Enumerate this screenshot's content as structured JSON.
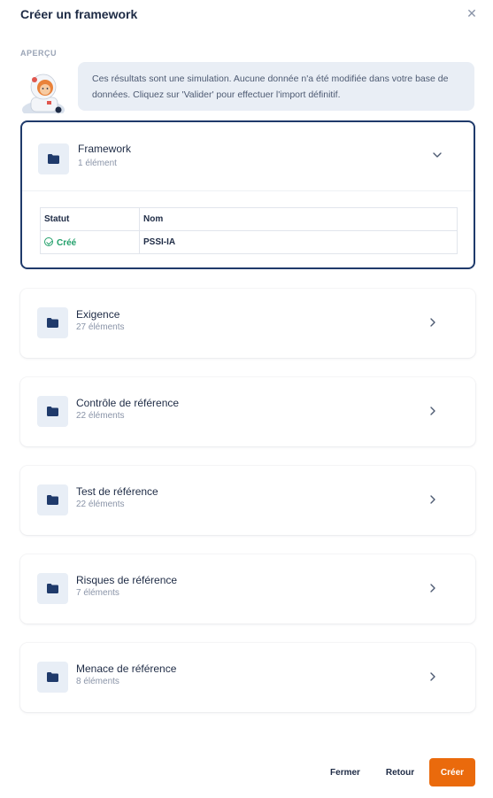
{
  "modal": {
    "title": "Créer un framework",
    "close_icon": "close-icon"
  },
  "preview": {
    "label": "APERÇU",
    "message": "Ces résultats sont une simulation. Aucune donnée n'a été modifiée dans votre base de données. Cliquez sur 'Valider' pour effectuer l'import définitif."
  },
  "cards": [
    {
      "title": "Framework",
      "subtitle": "1 élément",
      "expanded": true
    },
    {
      "title": "Exigence",
      "subtitle": "27 éléments",
      "expanded": false
    },
    {
      "title": "Contrôle de référence",
      "subtitle": "22 éléments",
      "expanded": false
    },
    {
      "title": "Test de référence",
      "subtitle": "22 éléments",
      "expanded": false
    },
    {
      "title": "Risques de référence",
      "subtitle": "7 éléments",
      "expanded": false
    },
    {
      "title": "Menace de référence",
      "subtitle": "8 éléments",
      "expanded": false
    }
  ],
  "framework_table": {
    "headers": [
      "Statut",
      "Nom"
    ],
    "rows": [
      {
        "status": "Créé",
        "name": "PSSI-IA"
      }
    ]
  },
  "footer": {
    "close_label": "Fermer",
    "back_label": "Retour",
    "create_label": "Créer"
  },
  "colors": {
    "primary": "#ea6a0c",
    "selected_border": "#1f3a6b",
    "success": "#22a06b"
  }
}
